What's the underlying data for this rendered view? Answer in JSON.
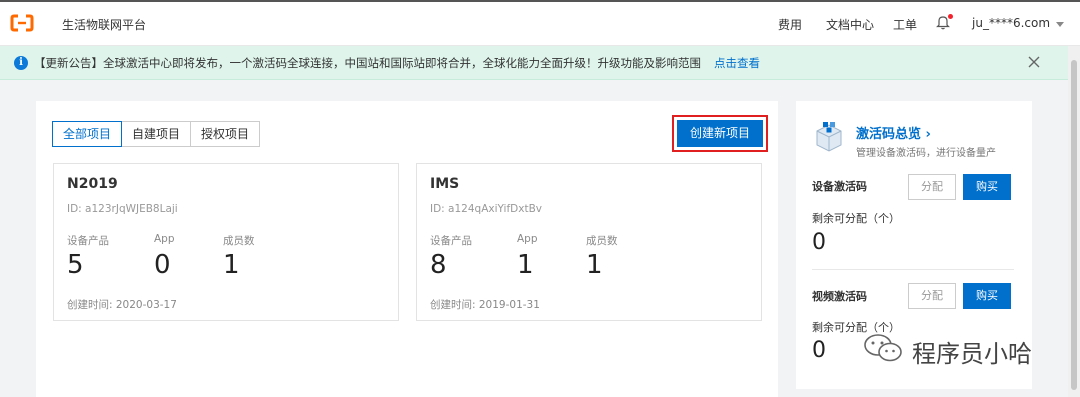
{
  "topbar": {
    "app_title": "生活物联网平台",
    "nav": [
      "费用",
      "文档中心",
      "工单"
    ],
    "user": "ju_****6.com"
  },
  "notice": {
    "text": "【更新公告】全球激活中心即将发布，一个激活码全球连接，中国站和国际站即将合并，全球化能力全面升级！升级功能及影响范围",
    "link": "点击查看"
  },
  "tabs": [
    "全部项目",
    "自建项目",
    "授权项目"
  ],
  "create_button": "创建新项目",
  "projects": [
    {
      "name": "N2019",
      "id": "ID: a123rJqWJEB8Laji",
      "stats": [
        {
          "label": "设备产品",
          "value": "5"
        },
        {
          "label": "App",
          "value": "0"
        },
        {
          "label": "成员数",
          "value": "1"
        }
      ],
      "created": "创建时间: 2020-03-17"
    },
    {
      "name": "IMS",
      "id": "ID: a124qAxiYifDxtBv",
      "stats": [
        {
          "label": "设备产品",
          "value": "8"
        },
        {
          "label": "App",
          "value": "1"
        },
        {
          "label": "成员数",
          "value": "1"
        }
      ],
      "created": "创建时间: 2019-01-31"
    }
  ],
  "side": {
    "title": "激活码总览 ›",
    "subtitle": "管理设备激活码，进行设备量产",
    "sections": [
      {
        "label": "设备激活码",
        "assign": "分配",
        "buy": "购买",
        "remain_label": "剩余可分配（个）",
        "remain_value": "0"
      },
      {
        "label": "视频激活码",
        "assign": "分配",
        "buy": "购买",
        "remain_label": "剩余可分配（个）",
        "remain_value": "0"
      }
    ]
  },
  "watermark": "程序员小哈",
  "colors": {
    "accent": "#0070cc",
    "notice_bg": "#dff5ec",
    "highlight_border": "#e02020",
    "logo": "#ff6a00"
  }
}
